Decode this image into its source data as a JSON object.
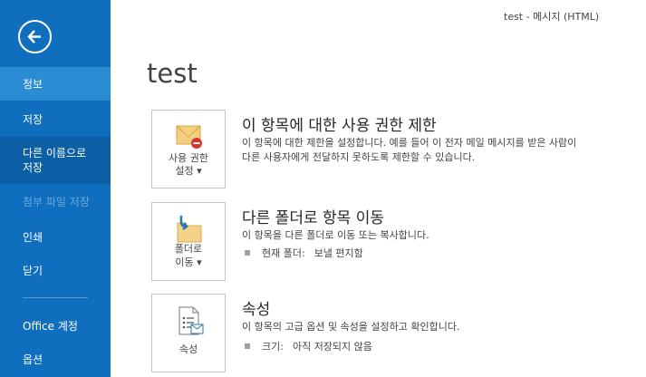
{
  "window": {
    "title": "test - 메시지 (HTML)"
  },
  "sidebar": {
    "items": [
      {
        "label": "정보"
      },
      {
        "label": "저장"
      },
      {
        "label": "다른 이름으로\n저장"
      },
      {
        "label": "첨부 파일 저장"
      },
      {
        "label": "인쇄"
      },
      {
        "label": "닫기"
      },
      {
        "label": "Office 계정"
      },
      {
        "label": "옵션"
      }
    ]
  },
  "main": {
    "title": "test",
    "sections": [
      {
        "button_label_line1": "사용 권한",
        "button_label_line2": "설정 ▾",
        "title": "이 항목에 대한 사용 권한 제한",
        "desc_line1": "이 항목에 대한 제한을 설정합니다. 예를 들어 이 전자 메일 메시지를 받은 사람이",
        "desc_line2": "다른 사용자에게 전달하지 못하도록 제한할 수 있습니다."
      },
      {
        "button_label_line1": "폴더로",
        "button_label_line2": "이동 ▾",
        "title": "다른 폴더로 항목 이동",
        "desc_line1": "이 항목을 다른 폴더로 이동 또는 복사합니다.",
        "detail_label": "현재 폴더:",
        "detail_value": "보낼 편지함"
      },
      {
        "button_label_line1": "속성",
        "title": "속성",
        "desc_line1": "이 항목의 고급 옵션 및 속성을 설정하고 확인합니다.",
        "detail_label": "크기:",
        "detail_value": "아직 저장되지 않음"
      }
    ]
  }
}
